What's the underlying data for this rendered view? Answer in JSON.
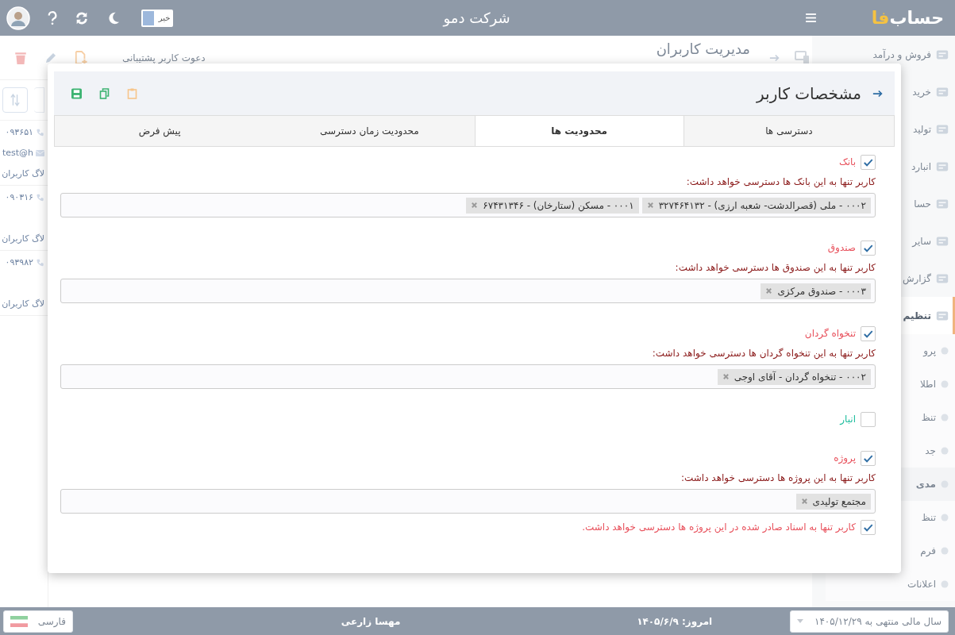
{
  "topbar": {
    "logo": {
      "text": "حساب",
      "accent": "فا"
    },
    "company": "شرکت دمو",
    "toggle": {
      "label": "خیر",
      "on": false
    }
  },
  "sidebar": {
    "items": [
      {
        "label": "فروش و درآمد",
        "selected": false
      },
      {
        "label": "خرید",
        "selected": false
      },
      {
        "label": "تولید",
        "selected": false
      },
      {
        "label": "انبارد",
        "selected": false
      },
      {
        "label": "حسا",
        "selected": false
      },
      {
        "label": "سایر",
        "selected": false
      },
      {
        "label": "گزارش",
        "selected": false
      },
      {
        "label": "تنظیم",
        "selected": true,
        "expanded": true,
        "children": [
          {
            "label": "پرو",
            "selected": false
          },
          {
            "label": "اطلا",
            "selected": false
          },
          {
            "label": "تنظ",
            "selected": false
          },
          {
            "label": "جد",
            "selected": false
          },
          {
            "label": "مدی",
            "selected": true
          },
          {
            "label": "تنظ",
            "selected": false
          },
          {
            "label": "فرم",
            "selected": false
          },
          {
            "label": "اعلانات",
            "selected": false
          }
        ]
      }
    ]
  },
  "page": {
    "title": "مدیریت کاربران",
    "invite": "دعوت کاربر پشتیبانی",
    "users": [
      {
        "phone": "۰۹۳۶۵۱",
        "email": "test@h",
        "log": "لاگ کاربران"
      },
      {
        "phone": "۰۹۰۳۱۶",
        "log": "لاگ کاربران"
      },
      {
        "phone": "۰۹۳۹۸۲",
        "log": "لاگ کاربران"
      }
    ]
  },
  "modal": {
    "title": "مشخصات کاربر",
    "tabs": [
      {
        "label": "دسترسی ها",
        "selected": false
      },
      {
        "label": "محدودیت ها",
        "selected": true
      },
      {
        "label": "محدودیت زمان دسترسی",
        "selected": false
      },
      {
        "label": "پیش فرض",
        "selected": false
      }
    ],
    "sections": [
      {
        "kind": "restriction",
        "label": "بانک",
        "checked": true,
        "note": "کاربر تنها به این بانک ها دسترسی خواهد داشت:",
        "tags": [
          "۰۰۰۲ - ملی (قصرالدشت- شعبه ارزی) - ۳۲۷۴۶۴۱۳۲",
          "۰۰۰۱ - مسکن (ستارخان) - ۶۷۴۳۱۳۴۶"
        ]
      },
      {
        "kind": "restriction",
        "label": "صندوق",
        "checked": true,
        "note": "کاربر تنها به این صندوق ها دسترسی خواهد داشت:",
        "tags": [
          "۰۰۰۳ - صندوق مرکزی"
        ]
      },
      {
        "kind": "restriction",
        "label": "تنخواه گردان",
        "checked": true,
        "note": "کاربر تنها به این تنخواه گردان ها دسترسی خواهد داشت:",
        "tags": [
          "۰۰۰۲ - تنخواه گردان - آقای اوجی"
        ]
      },
      {
        "kind": "restriction",
        "label": "انبار",
        "checked": false
      },
      {
        "kind": "restriction",
        "label": "پروژه",
        "checked": true,
        "note": "کاربر تنها به این پروژه ها دسترسی خواهد داشت:",
        "tags": [
          "مجتمع تولیدی"
        ]
      },
      {
        "kind": "option",
        "label": "کاربر تنها به اسناد صادر شده در این پروژه ها دسترسی خواهد داشت.",
        "checked": true
      }
    ]
  },
  "statusbar": {
    "fiscal_year": "سال مالی منتهی به ۱۴۰۵/۱۲/۲۹",
    "today": "امروز: ۱۴۰۵/۶/۹",
    "user": "مهسا زارعی",
    "language": "فارسی"
  }
}
